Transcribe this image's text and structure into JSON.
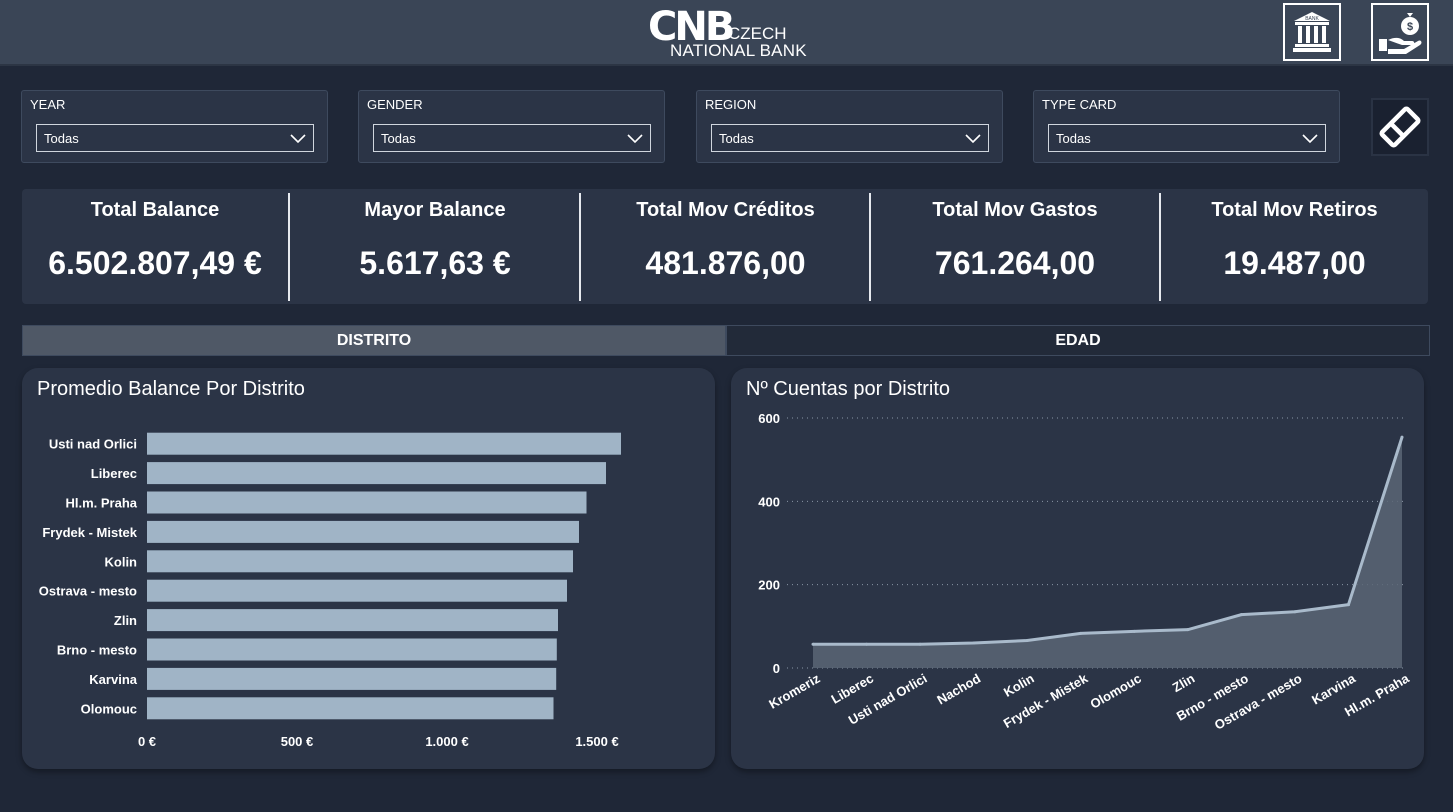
{
  "header": {
    "logo_main": "CNB",
    "logo_line1": "CZECH",
    "logo_line2": "NATIONAL BANK",
    "bank_icon_label": "BANK",
    "icons": [
      "bank-icon",
      "money-hand-icon"
    ]
  },
  "slicers": [
    {
      "label": "YEAR",
      "value": "Todas"
    },
    {
      "label": "GENDER",
      "value": "Todas"
    },
    {
      "label": "REGION",
      "value": "Todas"
    },
    {
      "label": "TYPE CARD",
      "value": "Todas"
    }
  ],
  "kpis": [
    {
      "title": "Total Balance",
      "value": "6.502.807,49 €"
    },
    {
      "title": "Mayor Balance",
      "value": "5.617,63 €"
    },
    {
      "title": "Total Mov Créditos",
      "value": "481.876,00"
    },
    {
      "title": "Total Mov Gastos",
      "value": "761.264,00"
    },
    {
      "title": "Total Mov Retiros",
      "value": "19.487,00"
    }
  ],
  "tabs": [
    {
      "label": "DISTRITO",
      "active": true
    },
    {
      "label": "EDAD",
      "active": false
    }
  ],
  "colors": {
    "background": "#1f2737",
    "panel": "#2b3446",
    "bar": "#a0b4c6",
    "line": "#a9bacb",
    "area": "#5b6676"
  },
  "chart_data": [
    {
      "type": "bar",
      "orientation": "horizontal",
      "title": "Promedio Balance Por Distrito",
      "categories": [
        "Usti nad Orlici",
        "Liberec",
        "Hl.m. Praha",
        "Frydek - Mistek",
        "Kolin",
        "Ostrava - mesto",
        "Zlin",
        "Brno - mesto",
        "Karvina",
        "Olomouc"
      ],
      "values": [
        1580,
        1530,
        1465,
        1440,
        1420,
        1400,
        1370,
        1366,
        1364,
        1355
      ],
      "xlim": [
        0,
        1800
      ],
      "tick_values": [
        0,
        500,
        1000,
        1500
      ],
      "tick_labels": [
        "0 €",
        "500 €",
        "1.000 €",
        "1.500 €"
      ]
    },
    {
      "type": "area",
      "title": "Nº Cuentas por Distrito",
      "categories": [
        "Kromeriz",
        "Liberec",
        "Usti nad Orlici",
        "Nachod",
        "Kolin",
        "Frydek - Mistek",
        "Olomouc",
        "Zlin",
        "Brno - mesto",
        "Ostrava - mesto",
        "Karvina",
        "Hl.m. Praha"
      ],
      "values": [
        57,
        57,
        57,
        60,
        66,
        83,
        88,
        92,
        128,
        135,
        152,
        554
      ],
      "ylim": [
        0,
        600
      ],
      "yticks": [
        "0",
        "200",
        "400",
        "600"
      ],
      "grid": true
    }
  ]
}
